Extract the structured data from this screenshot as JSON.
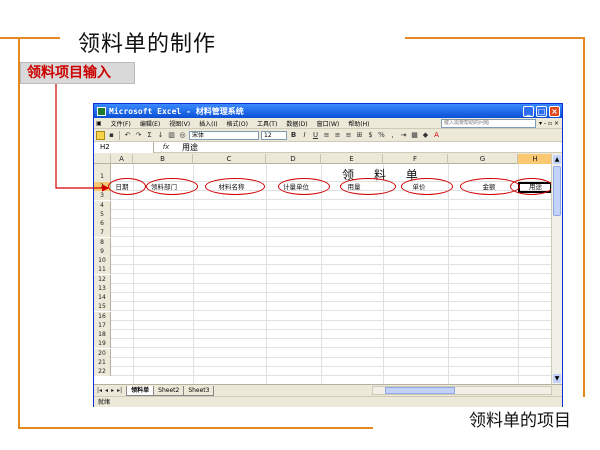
{
  "slide": {
    "title": "领料单的制作",
    "tag": "领料项目输入",
    "caption": "领料单的项目"
  },
  "colors": {
    "accent": "#e58a1e",
    "annotation": "#d10000",
    "tag_text": "#cc0000",
    "titlebar": "#0a4fd6"
  },
  "window": {
    "title": "Microsoft Excel - 材料管理系统",
    "menu": [
      "文件(F)",
      "编辑(E)",
      "视图(V)",
      "插入(I)",
      "格式(O)",
      "工具(T)",
      "数据(D)",
      "窗口(W)",
      "帮助(H)"
    ],
    "help_placeholder": "键入需要帮助的问题",
    "font_name": "宋体",
    "font_size": "12",
    "name_box": "H2",
    "fx": "fx",
    "formula": "用途",
    "status": "就绪"
  },
  "grid": {
    "columns": [
      "A",
      "B",
      "C",
      "D",
      "E",
      "F",
      "G",
      "H"
    ],
    "selected_column": "H",
    "selected_row": 2,
    "rows": [
      1,
      2,
      3,
      4,
      5,
      6,
      7,
      8,
      9,
      10,
      11,
      12,
      13,
      14,
      15,
      16,
      17,
      18,
      19,
      20,
      21,
      22
    ],
    "sheet_title": "领 料 单",
    "headers": [
      "日期",
      "领料部门",
      "材料名称",
      "计量单位",
      "用量",
      "单价",
      "金额",
      "用途"
    ]
  },
  "tabs": [
    "领料单",
    "Sheet2",
    "Sheet3"
  ],
  "active_tab": "领料单"
}
